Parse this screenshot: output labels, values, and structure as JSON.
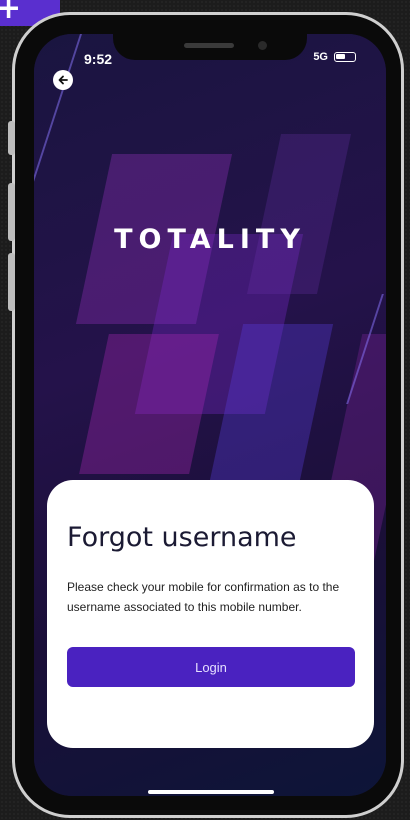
{
  "status_bar": {
    "time": "9:52",
    "network": "5G"
  },
  "logo_text": "TOTALITY",
  "card": {
    "title": "Forgot username",
    "message": "Please check your mobile for confirmation as to the username associated to this mobile number.",
    "login_label": "Login"
  },
  "corner_badge": "+",
  "colors": {
    "accent": "#4a22c0",
    "badge": "#5a2fcf",
    "background": "#150f2e"
  },
  "icons": {
    "back": "arrow-left-icon",
    "battery": "battery-icon"
  }
}
